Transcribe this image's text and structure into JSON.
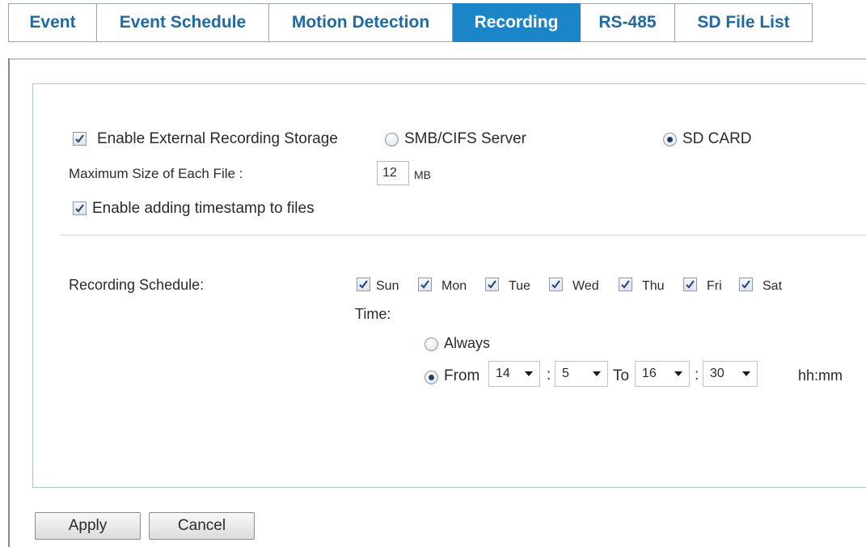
{
  "tabs": [
    {
      "label": "Event"
    },
    {
      "label": "Event Schedule"
    },
    {
      "label": "Motion Detection"
    },
    {
      "label": "Recording",
      "active": true
    },
    {
      "label": "RS-485"
    },
    {
      "label": "SD File List"
    }
  ],
  "storage": {
    "enable_label": "Enable External Recording Storage",
    "enable_checked": true,
    "smb_label": "SMB/CIFS Server",
    "smb_selected": false,
    "sd_label": "SD CARD",
    "sd_selected": true
  },
  "file_size": {
    "label": "Maximum Size of Each File :",
    "value": "12",
    "unit": "MB"
  },
  "timestamp": {
    "label": "Enable adding timestamp to files",
    "checked": true
  },
  "schedule": {
    "label": "Recording Schedule:",
    "days": [
      {
        "label": "Sun",
        "checked": true
      },
      {
        "label": "Mon",
        "checked": true
      },
      {
        "label": "Tue",
        "checked": true
      },
      {
        "label": "Wed",
        "checked": true
      },
      {
        "label": "Thu",
        "checked": true
      },
      {
        "label": "Fri",
        "checked": true
      },
      {
        "label": "Sat",
        "checked": true
      }
    ],
    "time_label": "Time:",
    "always_label": "Always",
    "always_selected": false,
    "from_label": "From",
    "from_selected": true,
    "from_hour": "14",
    "from_minute": "5",
    "to_label": "To",
    "to_hour": "16",
    "to_minute": "30",
    "colon": ":",
    "format_label": "hh:mm"
  },
  "buttons": {
    "apply": "Apply",
    "cancel": "Cancel"
  },
  "colors": {
    "accent": "#1a86c8",
    "tab_text": "#1d6aa4"
  },
  "icons": {
    "check": "checkmark-icon",
    "caret": "chevron-down-icon"
  }
}
